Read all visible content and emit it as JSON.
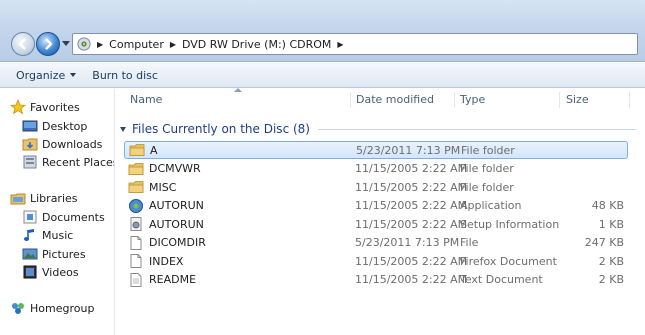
{
  "address": {
    "crumbs": [
      "Computer",
      "DVD RW Drive (M:) CDROM"
    ]
  },
  "toolbar": {
    "organize_label": "Organize",
    "burn_label": "Burn to disc"
  },
  "navpane": {
    "favorites": {
      "label": "Favorites",
      "items": [
        "Desktop",
        "Downloads",
        "Recent Places"
      ]
    },
    "libraries": {
      "label": "Libraries",
      "items": [
        "Documents",
        "Music",
        "Pictures",
        "Videos"
      ]
    },
    "homegroup": {
      "label": "Homegroup"
    }
  },
  "columns": {
    "name": "Name",
    "date": "Date modified",
    "type": "Type",
    "size": "Size"
  },
  "group": {
    "label": "Files Currently on the Disc (8)"
  },
  "files": [
    {
      "name": "A",
      "date": "5/23/2011 7:13 PM",
      "type": "File folder",
      "size": "",
      "icon": "folder-icon",
      "selected": true
    },
    {
      "name": "DCMVWR",
      "date": "11/15/2005 2:22 AM",
      "type": "File folder",
      "size": "",
      "icon": "folder-icon"
    },
    {
      "name": "MISC",
      "date": "11/15/2005 2:22 AM",
      "type": "File folder",
      "size": "",
      "icon": "folder-icon"
    },
    {
      "name": "AUTORUN",
      "date": "11/15/2005 2:22 AM",
      "type": "Application",
      "size": "48 KB",
      "icon": "application-icon"
    },
    {
      "name": "AUTORUN",
      "date": "11/15/2005 2:22 AM",
      "type": "Setup Information",
      "size": "1 KB",
      "icon": "setup-info-icon"
    },
    {
      "name": "DICOMDIR",
      "date": "5/23/2011 7:13 PM",
      "type": "File",
      "size": "247 KB",
      "icon": "file-icon"
    },
    {
      "name": "INDEX",
      "date": "11/15/2005 2:22 AM",
      "type": "Firefox Document",
      "size": "2 KB",
      "icon": "file-icon"
    },
    {
      "name": "README",
      "date": "11/15/2005 2:22 AM",
      "type": "Text Document",
      "size": "2 KB",
      "icon": "text-file-icon"
    }
  ],
  "colors": {
    "selection": "#d4e6fb",
    "group_text": "#1e3f8a",
    "link_blue": "#1e3c60"
  }
}
